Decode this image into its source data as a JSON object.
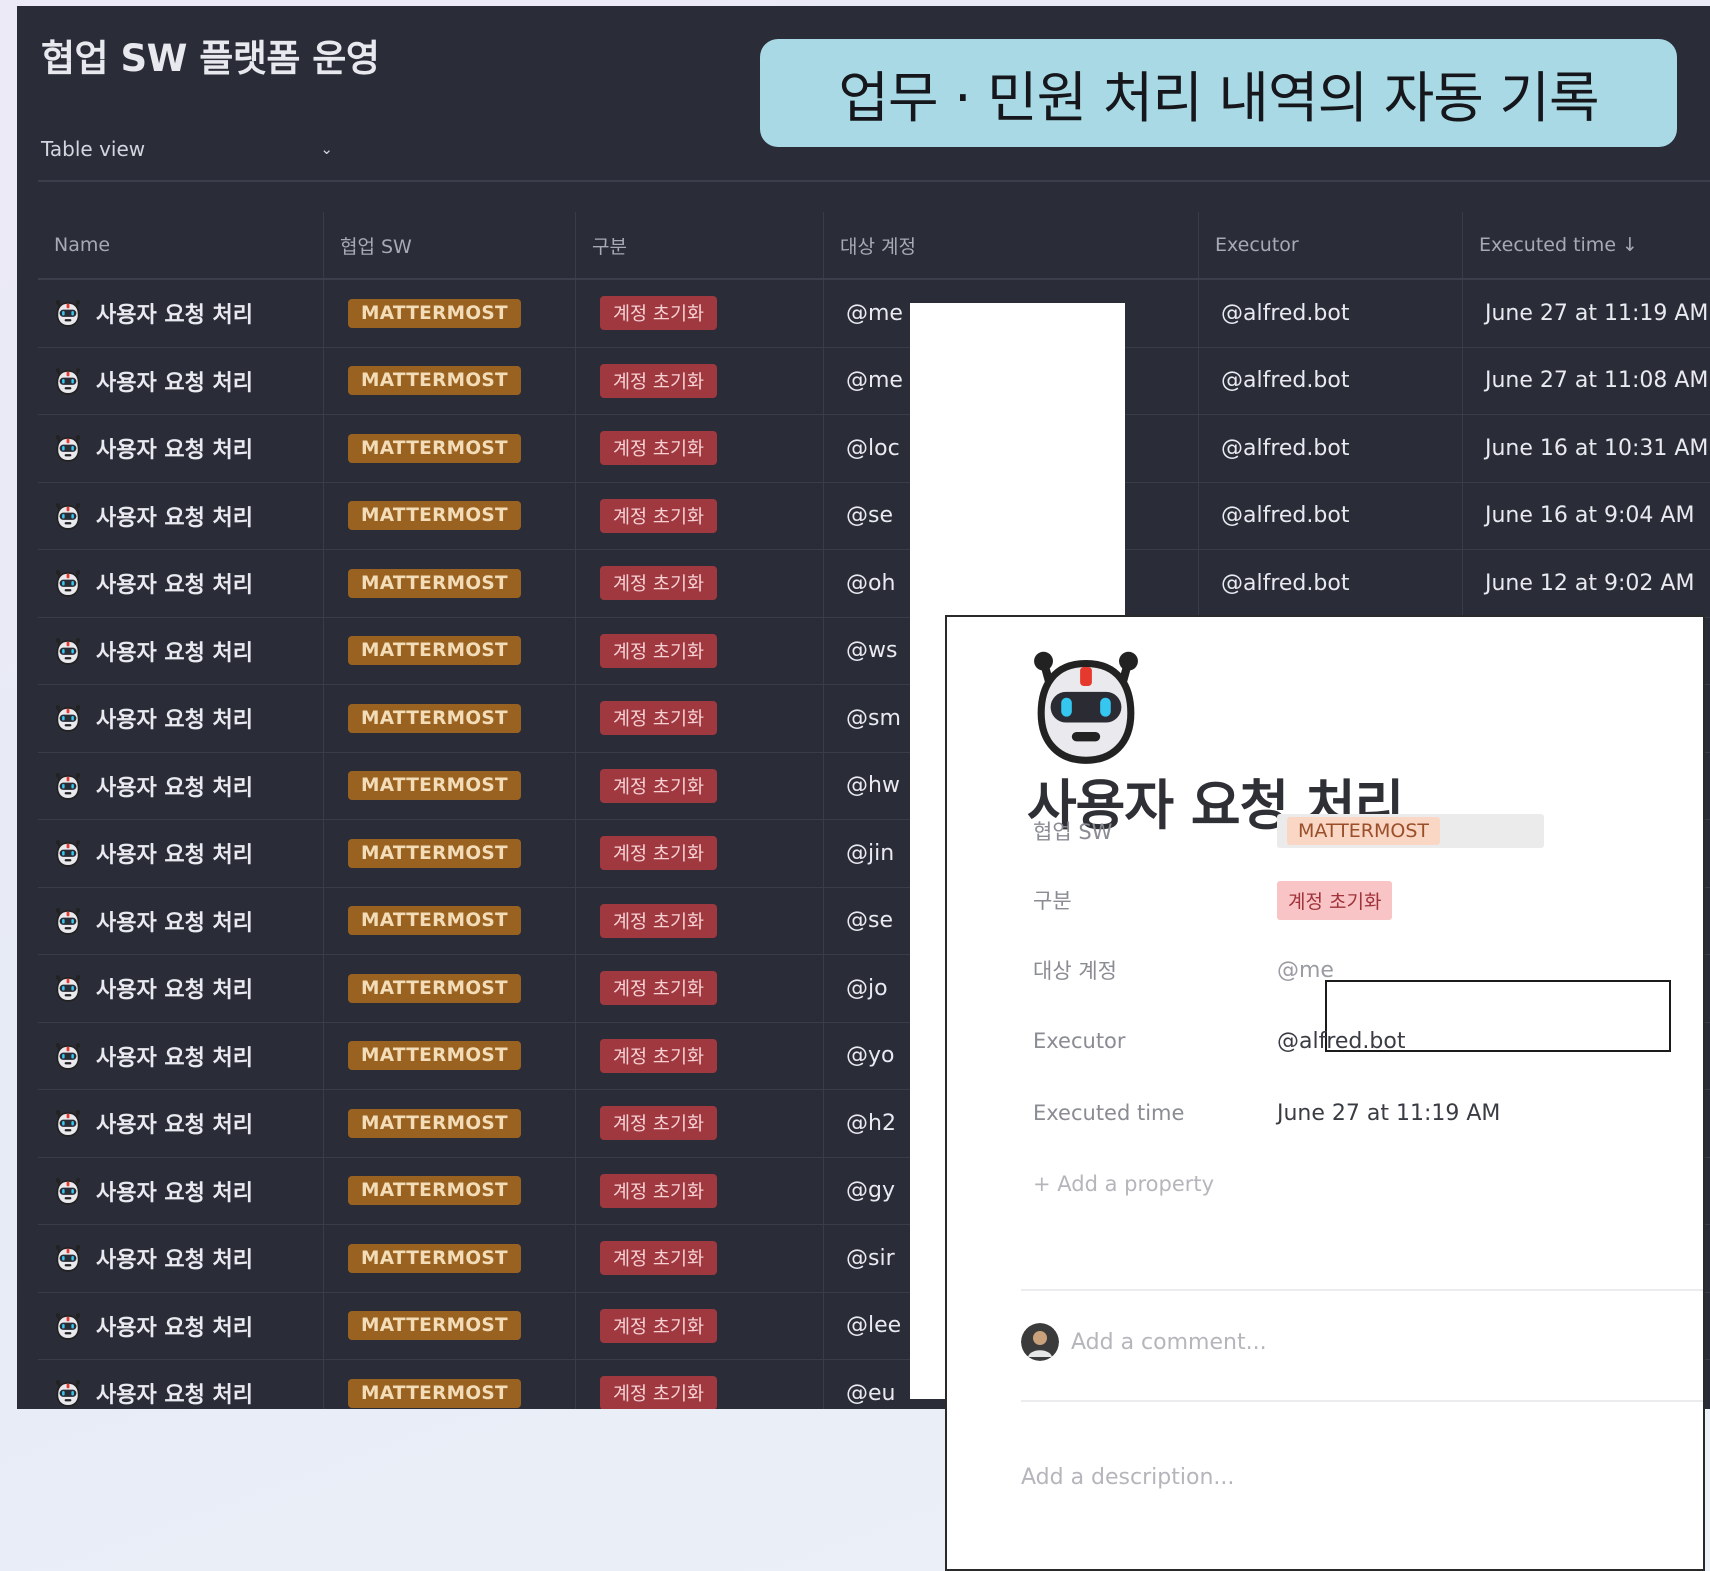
{
  "database": {
    "title": "협업 SW 플랫폼 운영",
    "view_label": "Table view",
    "view_chevron_icon": "chevron-down-icon"
  },
  "banner": {
    "text": "업무 · 민원 처리 내역의 자동 기록"
  },
  "table": {
    "columns": [
      "Name",
      "협업 SW",
      "구분",
      "대상 계정",
      "Executor",
      "Executed time ↓"
    ],
    "rows": [
      {
        "name": "사용자 요청 처리",
        "sw": "MATTERMOST",
        "type": "계정 초기화",
        "account": "@me",
        "executor": "@alfred.bot",
        "time": "June 27 at 11:19 AM"
      },
      {
        "name": "사용자 요청 처리",
        "sw": "MATTERMOST",
        "type": "계정 초기화",
        "account": "@me",
        "executor": "@alfred.bot",
        "time": "June 27 at 11:08 AM"
      },
      {
        "name": "사용자 요청 처리",
        "sw": "MATTERMOST",
        "type": "계정 초기화",
        "account": "@loc",
        "executor": "@alfred.bot",
        "time": "June 16 at 10:31 AM"
      },
      {
        "name": "사용자 요청 처리",
        "sw": "MATTERMOST",
        "type": "계정 초기화",
        "account": "@se",
        "executor": "@alfred.bot",
        "time": "June 16 at 9:04 AM"
      },
      {
        "name": "사용자 요청 처리",
        "sw": "MATTERMOST",
        "type": "계정 초기화",
        "account": "@oh",
        "executor": "@alfred.bot",
        "time": "June 12 at 9:02 AM"
      },
      {
        "name": "사용자 요청 처리",
        "sw": "MATTERMOST",
        "type": "계정 초기화",
        "account": "@ws",
        "executor": "",
        "time": ""
      },
      {
        "name": "사용자 요청 처리",
        "sw": "MATTERMOST",
        "type": "계정 초기화",
        "account": "@sm",
        "executor": "",
        "time": ""
      },
      {
        "name": "사용자 요청 처리",
        "sw": "MATTERMOST",
        "type": "계정 초기화",
        "account": "@hw",
        "executor": "",
        "time": ""
      },
      {
        "name": "사용자 요청 처리",
        "sw": "MATTERMOST",
        "type": "계정 초기화",
        "account": "@jin",
        "executor": "",
        "time": ""
      },
      {
        "name": "사용자 요청 처리",
        "sw": "MATTERMOST",
        "type": "계정 초기화",
        "account": "@se",
        "executor": "",
        "time": ""
      },
      {
        "name": "사용자 요청 처리",
        "sw": "MATTERMOST",
        "type": "계정 초기화",
        "account": "@jo",
        "executor": "",
        "time": ""
      },
      {
        "name": "사용자 요청 처리",
        "sw": "MATTERMOST",
        "type": "계정 초기화",
        "account": "@yo",
        "executor": "",
        "time": ""
      },
      {
        "name": "사용자 요청 처리",
        "sw": "MATTERMOST",
        "type": "계정 초기화",
        "account": "@h2",
        "executor": "",
        "time": ""
      },
      {
        "name": "사용자 요청 처리",
        "sw": "MATTERMOST",
        "type": "계정 초기화",
        "account": "@gy",
        "executor": "",
        "time": ""
      },
      {
        "name": "사용자 요청 처리",
        "sw": "MATTERMOST",
        "type": "계정 초기화",
        "account": "@sir",
        "executor": "",
        "time": ""
      },
      {
        "name": "사용자 요청 처리",
        "sw": "MATTERMOST",
        "type": "계정 초기화",
        "account": "@lee",
        "executor": "",
        "time": ""
      },
      {
        "name": "사용자 요청 처리",
        "sw": "MATTERMOST",
        "type": "계정 초기화",
        "account": "@eu",
        "executor": "",
        "time": ""
      }
    ],
    "row_icon": "robot-icon"
  },
  "detail": {
    "page_icon": "robot-icon",
    "title": "사용자 요청 처리",
    "properties": {
      "sw_label": "협업 SW",
      "sw_value": "MATTERMOST",
      "type_label": "구분",
      "type_value": "계정 초기화",
      "account_label": "대상 계정",
      "account_value": "@me",
      "executor_label": "Executor",
      "executor_value": "@alfred.bot",
      "time_label": "Executed time",
      "time_value": "June 27 at 11:19 AM"
    },
    "add_property": "+ Add a property",
    "comment_placeholder": "Add a comment...",
    "description_placeholder": "Add a description..."
  },
  "colors": {
    "dark_bg": "#2a2c38",
    "banner_bg": "#a9d9e4",
    "mattermost_tag": "#9a6220",
    "reset_tag": "#a0383f"
  }
}
